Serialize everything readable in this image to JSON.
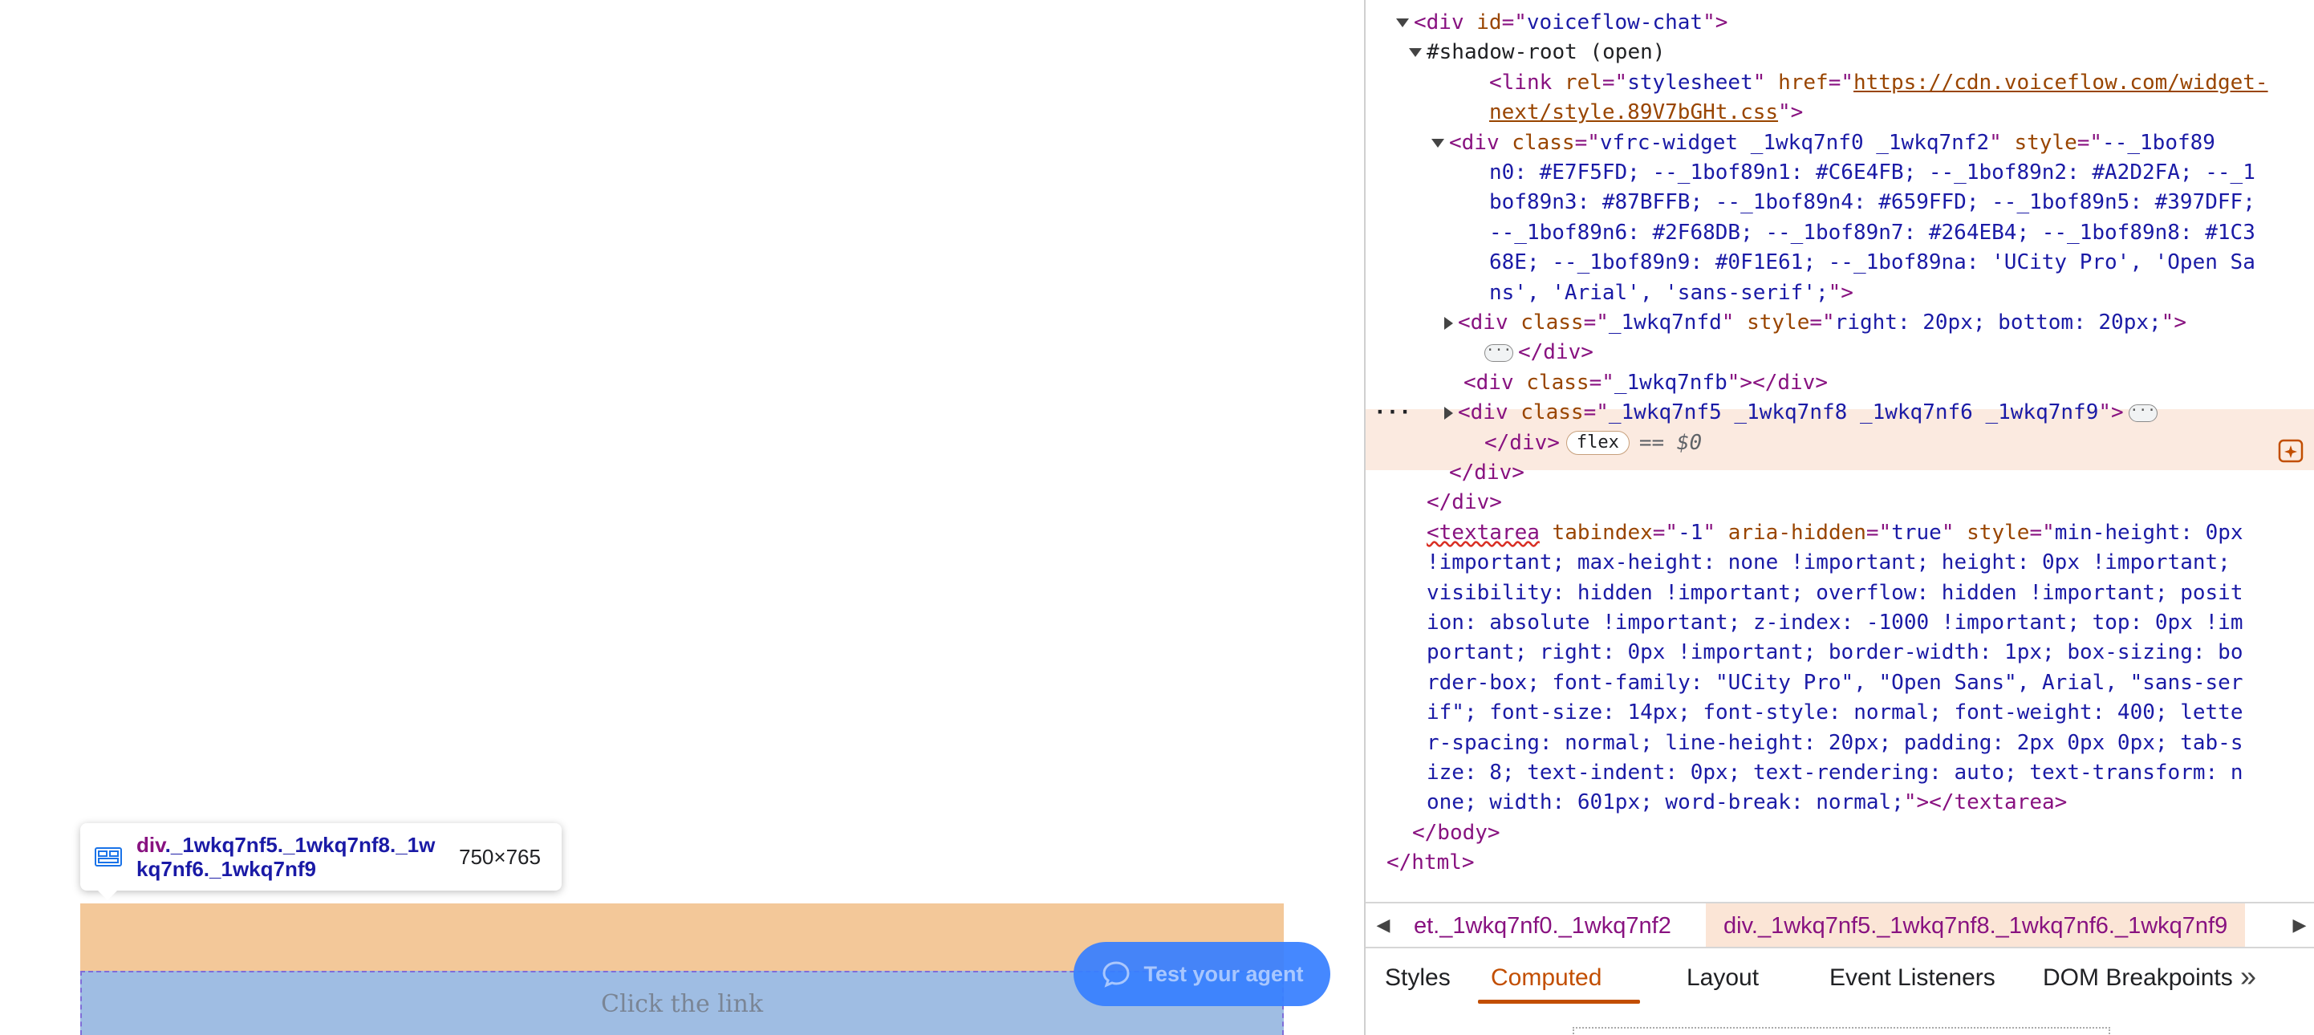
{
  "page": {
    "link_text": "Click the link",
    "launcher_label": "Test your agent",
    "inspect_tooltip": {
      "tag": "div",
      "selector": "._1wkq7nf5._1wkq7nf8._1wkq7nf6._1wkq7nf9",
      "size": "750×765"
    }
  },
  "devtools": {
    "lines": [
      {
        "t": [
          [
            "tag",
            "<div "
          ],
          [
            "attr",
            "id"
          ],
          [
            "tag",
            "=\""
          ],
          [
            "val",
            "voiceflow-chat"
          ],
          [
            "tag",
            "\">"
          ]
        ]
      },
      {
        "t": [
          [
            "text",
            "#shadow-root (open)"
          ]
        ]
      },
      {
        "t": [
          [
            "tag",
            "<link "
          ],
          [
            "attr",
            "rel"
          ],
          [
            "tag",
            "=\""
          ],
          [
            "val",
            "stylesheet"
          ],
          [
            "tag",
            "\" "
          ],
          [
            "attr",
            "href"
          ],
          [
            "tag",
            "=\""
          ],
          [
            "link",
            "https://cdn.voiceflow.com/widget-"
          ]
        ]
      },
      {
        "t": [
          [
            "link",
            "next/style.89V7bGHt.css"
          ],
          [
            "tag",
            "\">"
          ]
        ]
      },
      {
        "t": [
          [
            "tag",
            "<div "
          ],
          [
            "attr",
            "class"
          ],
          [
            "tag",
            "=\""
          ],
          [
            "val",
            "vfrc-widget _1wkq7nf0 _1wkq7nf2"
          ],
          [
            "tag",
            "\" "
          ],
          [
            "attr",
            "style"
          ],
          [
            "tag",
            "=\""
          ],
          [
            "val",
            "--_1bof89"
          ]
        ]
      },
      {
        "t": [
          [
            "val",
            "n0: #E7F5FD; --_1bof89n1: #C6E4FB; --_1bof89n2: #A2D2FA; --_1"
          ]
        ]
      },
      {
        "t": [
          [
            "val",
            "bof89n3: #87BFFB; --_1bof89n4: #659FFD; --_1bof89n5: #397DFF;"
          ]
        ]
      },
      {
        "t": [
          [
            "val",
            "--_1bof89n6: #2F68DB; --_1bof89n7: #264EB4; --_1bof89n8: #1C3"
          ]
        ]
      },
      {
        "t": [
          [
            "val",
            "68E; --_1bof89n9: #0F1E61; --_1bof89na: 'UCity Pro', 'Open Sa"
          ]
        ]
      },
      {
        "t": [
          [
            "val",
            "ns', 'Arial', 'sans-serif';"
          ],
          [
            "tag",
            "\">"
          ]
        ]
      },
      {
        "t": [
          [
            "tag",
            "<div "
          ],
          [
            "attr",
            "class"
          ],
          [
            "tag",
            "=\""
          ],
          [
            "val",
            "_1wkq7nfd"
          ],
          [
            "tag",
            "\" "
          ],
          [
            "attr",
            "style"
          ],
          [
            "tag",
            "=\""
          ],
          [
            "val",
            "right: 20px; bottom: 20px;"
          ],
          [
            "tag",
            "\">"
          ]
        ]
      },
      {
        "t": [
          [
            "tag",
            "</div>"
          ]
        ]
      },
      {
        "t": [
          [
            "tag",
            "<div "
          ],
          [
            "attr",
            "class"
          ],
          [
            "tag",
            "=\""
          ],
          [
            "val",
            "_1wkq7nfb"
          ],
          [
            "tag",
            "\"></div>"
          ]
        ]
      },
      {
        "t": [
          [
            "tag",
            "<div "
          ],
          [
            "attr",
            "class"
          ],
          [
            "tag",
            "=\""
          ],
          [
            "val",
            "_1wkq7nf5 _1wkq7nf8 _1wkq7nf6 _1wkq7nf9"
          ],
          [
            "tag",
            "\">"
          ]
        ]
      },
      {
        "t": [
          [
            "tag",
            "</div>"
          ]
        ]
      },
      {
        "t": [
          [
            "tag",
            "</div>"
          ]
        ]
      },
      {
        "t": [
          [
            "tag",
            "</div>"
          ]
        ]
      },
      {
        "t": [
          [
            "err",
            "<textarea"
          ],
          [
            "tag",
            " "
          ],
          [
            "attr",
            "tabindex"
          ],
          [
            "tag",
            "=\""
          ],
          [
            "val",
            "-1"
          ],
          [
            "tag",
            "\" "
          ],
          [
            "attr",
            "aria-hidden"
          ],
          [
            "tag",
            "=\""
          ],
          [
            "val",
            "true"
          ],
          [
            "tag",
            "\" "
          ],
          [
            "attr",
            "style"
          ],
          [
            "tag",
            "=\""
          ],
          [
            "val",
            "min-height: 0px"
          ]
        ]
      },
      {
        "t": [
          [
            "val",
            "!important; max-height: none !important; height: 0px !important;"
          ]
        ]
      },
      {
        "t": [
          [
            "val",
            "visibility: hidden !important; overflow: hidden !important; posit"
          ]
        ]
      },
      {
        "t": [
          [
            "val",
            "ion: absolute !important; z-index: -1000 !important; top: 0px !im"
          ]
        ]
      },
      {
        "t": [
          [
            "val",
            "portant; right: 0px !important; border-width: 1px; box-sizing: bo"
          ]
        ]
      },
      {
        "t": [
          [
            "val",
            "rder-box; font-family: \"UCity Pro\", \"Open Sans\", Arial, \"sans-ser"
          ]
        ]
      },
      {
        "t": [
          [
            "val",
            "if\"; font-size: 14px; font-style: normal; font-weight: 400; lette"
          ]
        ]
      },
      {
        "t": [
          [
            "val",
            "r-spacing: normal; line-height: 20px; padding: 2px 0px 0px; tab-s"
          ]
        ]
      },
      {
        "t": [
          [
            "val",
            "ize: 8; text-indent: 0px; text-rendering: auto; text-transform: n"
          ]
        ]
      },
      {
        "t": [
          [
            "val",
            "one; width: 601px; word-break: normal;"
          ],
          [
            "tag",
            "\"></textarea>"
          ]
        ]
      },
      {
        "t": [
          [
            "tag",
            "</body>"
          ]
        ]
      },
      {
        "t": [
          [
            "tag",
            "</html>"
          ]
        ]
      }
    ],
    "flex_badge": "flex",
    "dollar_ref": "== $0",
    "row_menu": "···",
    "breadcrumbs": [
      "et._1wkq7nf0._1wkq7nf2",
      "div._1wkq7nf5._1wkq7nf8._1wkq7nf6._1wkq7nf9"
    ],
    "tabs": [
      "Styles",
      "Computed",
      "Layout",
      "Event Listeners",
      "DOM Breakpoints"
    ],
    "tabs_more": "»",
    "active_tab": "Computed"
  }
}
